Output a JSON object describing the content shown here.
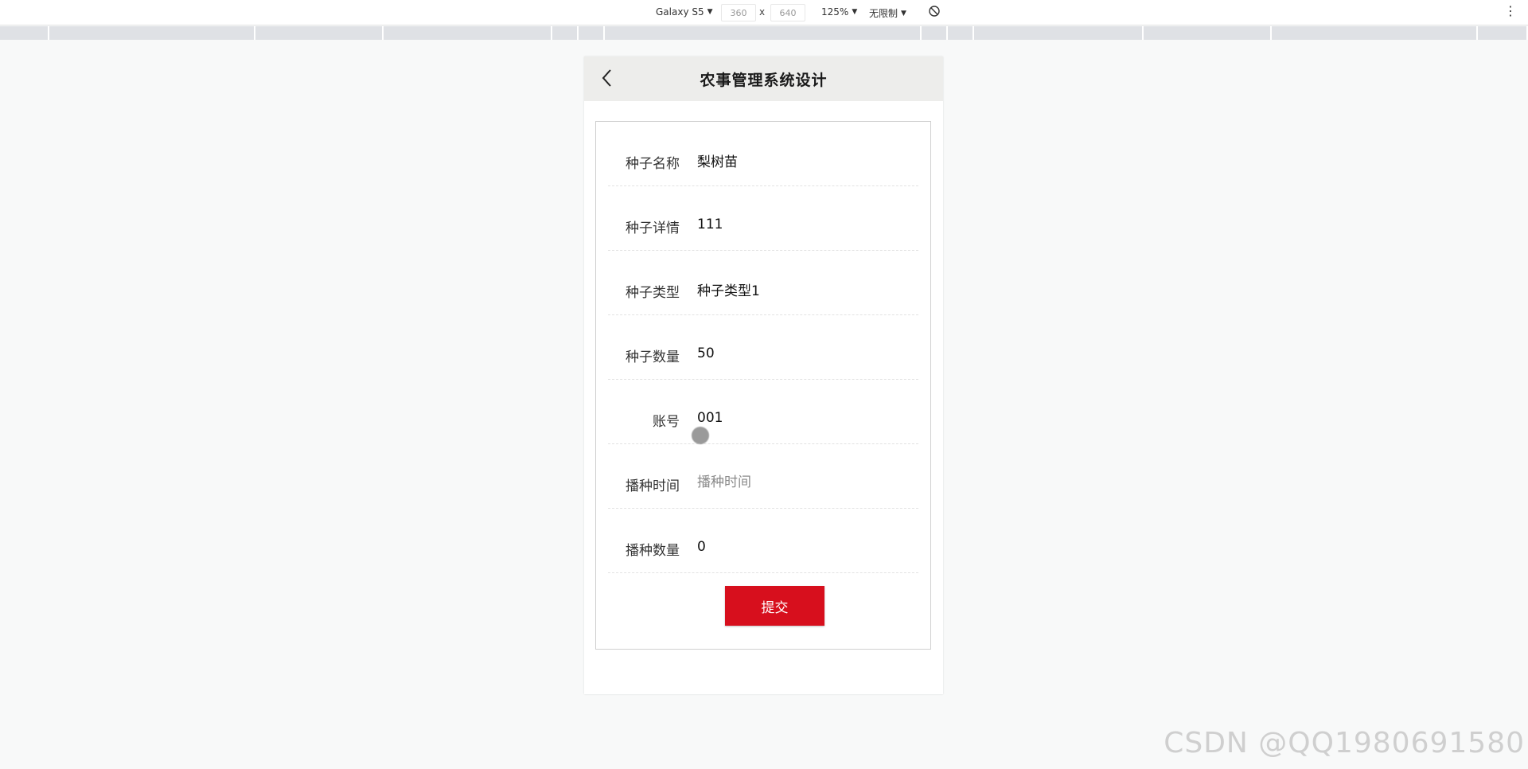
{
  "devtools": {
    "device": "Galaxy S5",
    "width": "360",
    "height": "640",
    "times": "x",
    "zoom": "125%",
    "throttle": "无限制",
    "caret": "▼",
    "more": "⋮"
  },
  "app": {
    "title": "农事管理系统设计",
    "back_icon": "chevron-left-icon"
  },
  "form": {
    "fields": [
      {
        "label": "种子名称",
        "value": "梨树苗",
        "placeholder": ""
      },
      {
        "label": "种子详情",
        "value": "111",
        "placeholder": ""
      },
      {
        "label": "种子类型",
        "value": "种子类型1",
        "placeholder": ""
      },
      {
        "label": "种子数量",
        "value": "50",
        "placeholder": ""
      },
      {
        "label": "账号",
        "value": "001",
        "placeholder": ""
      },
      {
        "label": "播种时间",
        "value": "",
        "placeholder": "播种时间"
      },
      {
        "label": "播种数量",
        "value": "0",
        "placeholder": ""
      }
    ],
    "submit_label": "提交"
  },
  "colors": {
    "accent": "#d70f1d",
    "header_bg": "#ededeb",
    "page_bg": "#f8f9f9"
  },
  "watermark": "CSDN @QQ1980691580"
}
